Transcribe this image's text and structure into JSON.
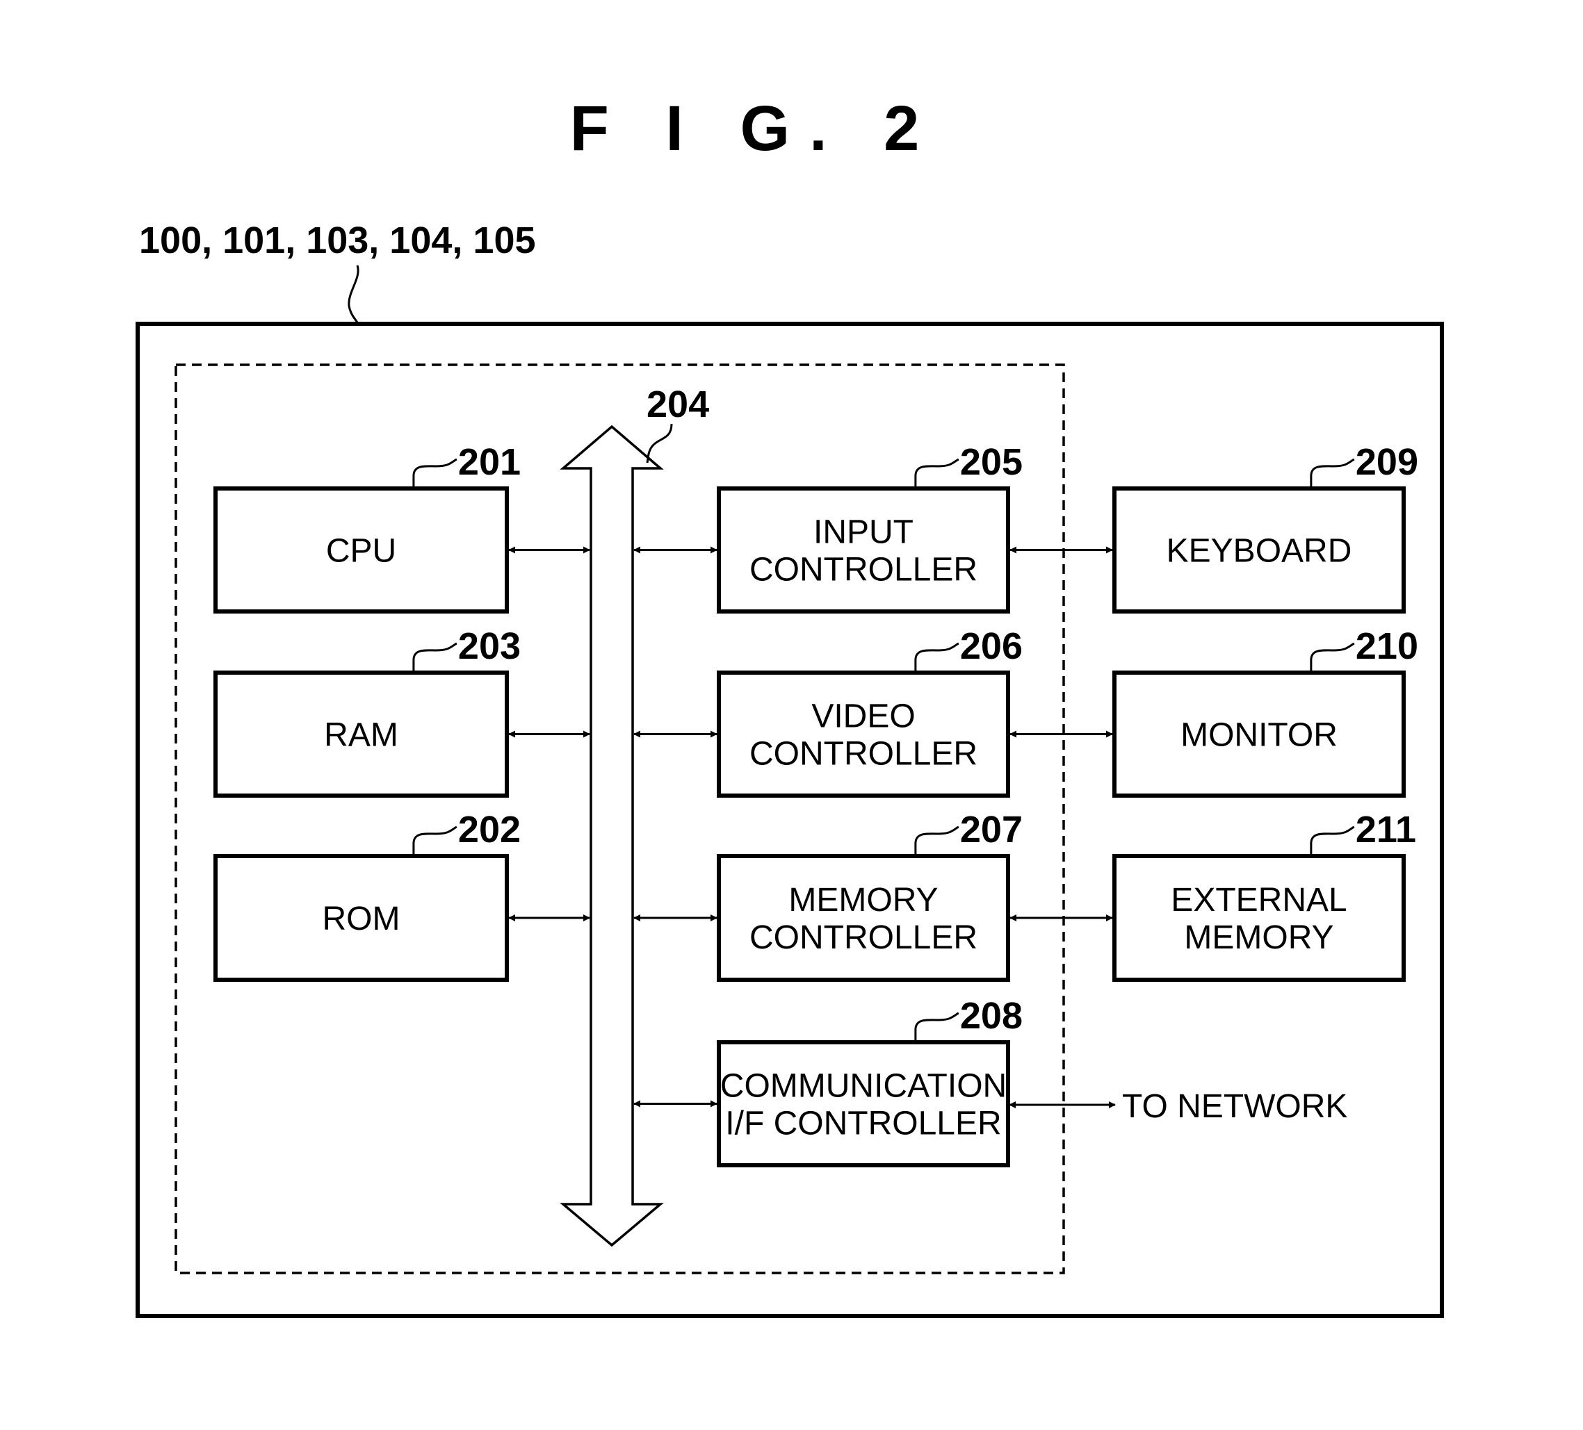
{
  "figure": {
    "title": "F I G. 2",
    "device_refs": "100, 101, 103, 104, 105",
    "bus": {
      "ref": "204"
    },
    "blocks": [
      {
        "id": "cpu",
        "ref": "201",
        "lines": [
          "CPU"
        ]
      },
      {
        "id": "ram",
        "ref": "203",
        "lines": [
          "RAM"
        ]
      },
      {
        "id": "rom",
        "ref": "202",
        "lines": [
          "ROM"
        ]
      },
      {
        "id": "input-controller",
        "ref": "205",
        "lines": [
          "INPUT",
          "CONTROLLER"
        ]
      },
      {
        "id": "video-controller",
        "ref": "206",
        "lines": [
          "VIDEO",
          "CONTROLLER"
        ]
      },
      {
        "id": "memory-controller",
        "ref": "207",
        "lines": [
          "MEMORY",
          "CONTROLLER"
        ]
      },
      {
        "id": "communication-if-controller",
        "ref": "208",
        "lines": [
          "COMMUNICATION",
          "I/F CONTROLLER"
        ]
      },
      {
        "id": "keyboard",
        "ref": "209",
        "lines": [
          "KEYBOARD"
        ]
      },
      {
        "id": "monitor",
        "ref": "210",
        "lines": [
          "MONITOR"
        ]
      },
      {
        "id": "external-memory",
        "ref": "211",
        "lines": [
          "EXTERNAL",
          "MEMORY"
        ]
      }
    ],
    "network_label": "TO NETWORK"
  }
}
